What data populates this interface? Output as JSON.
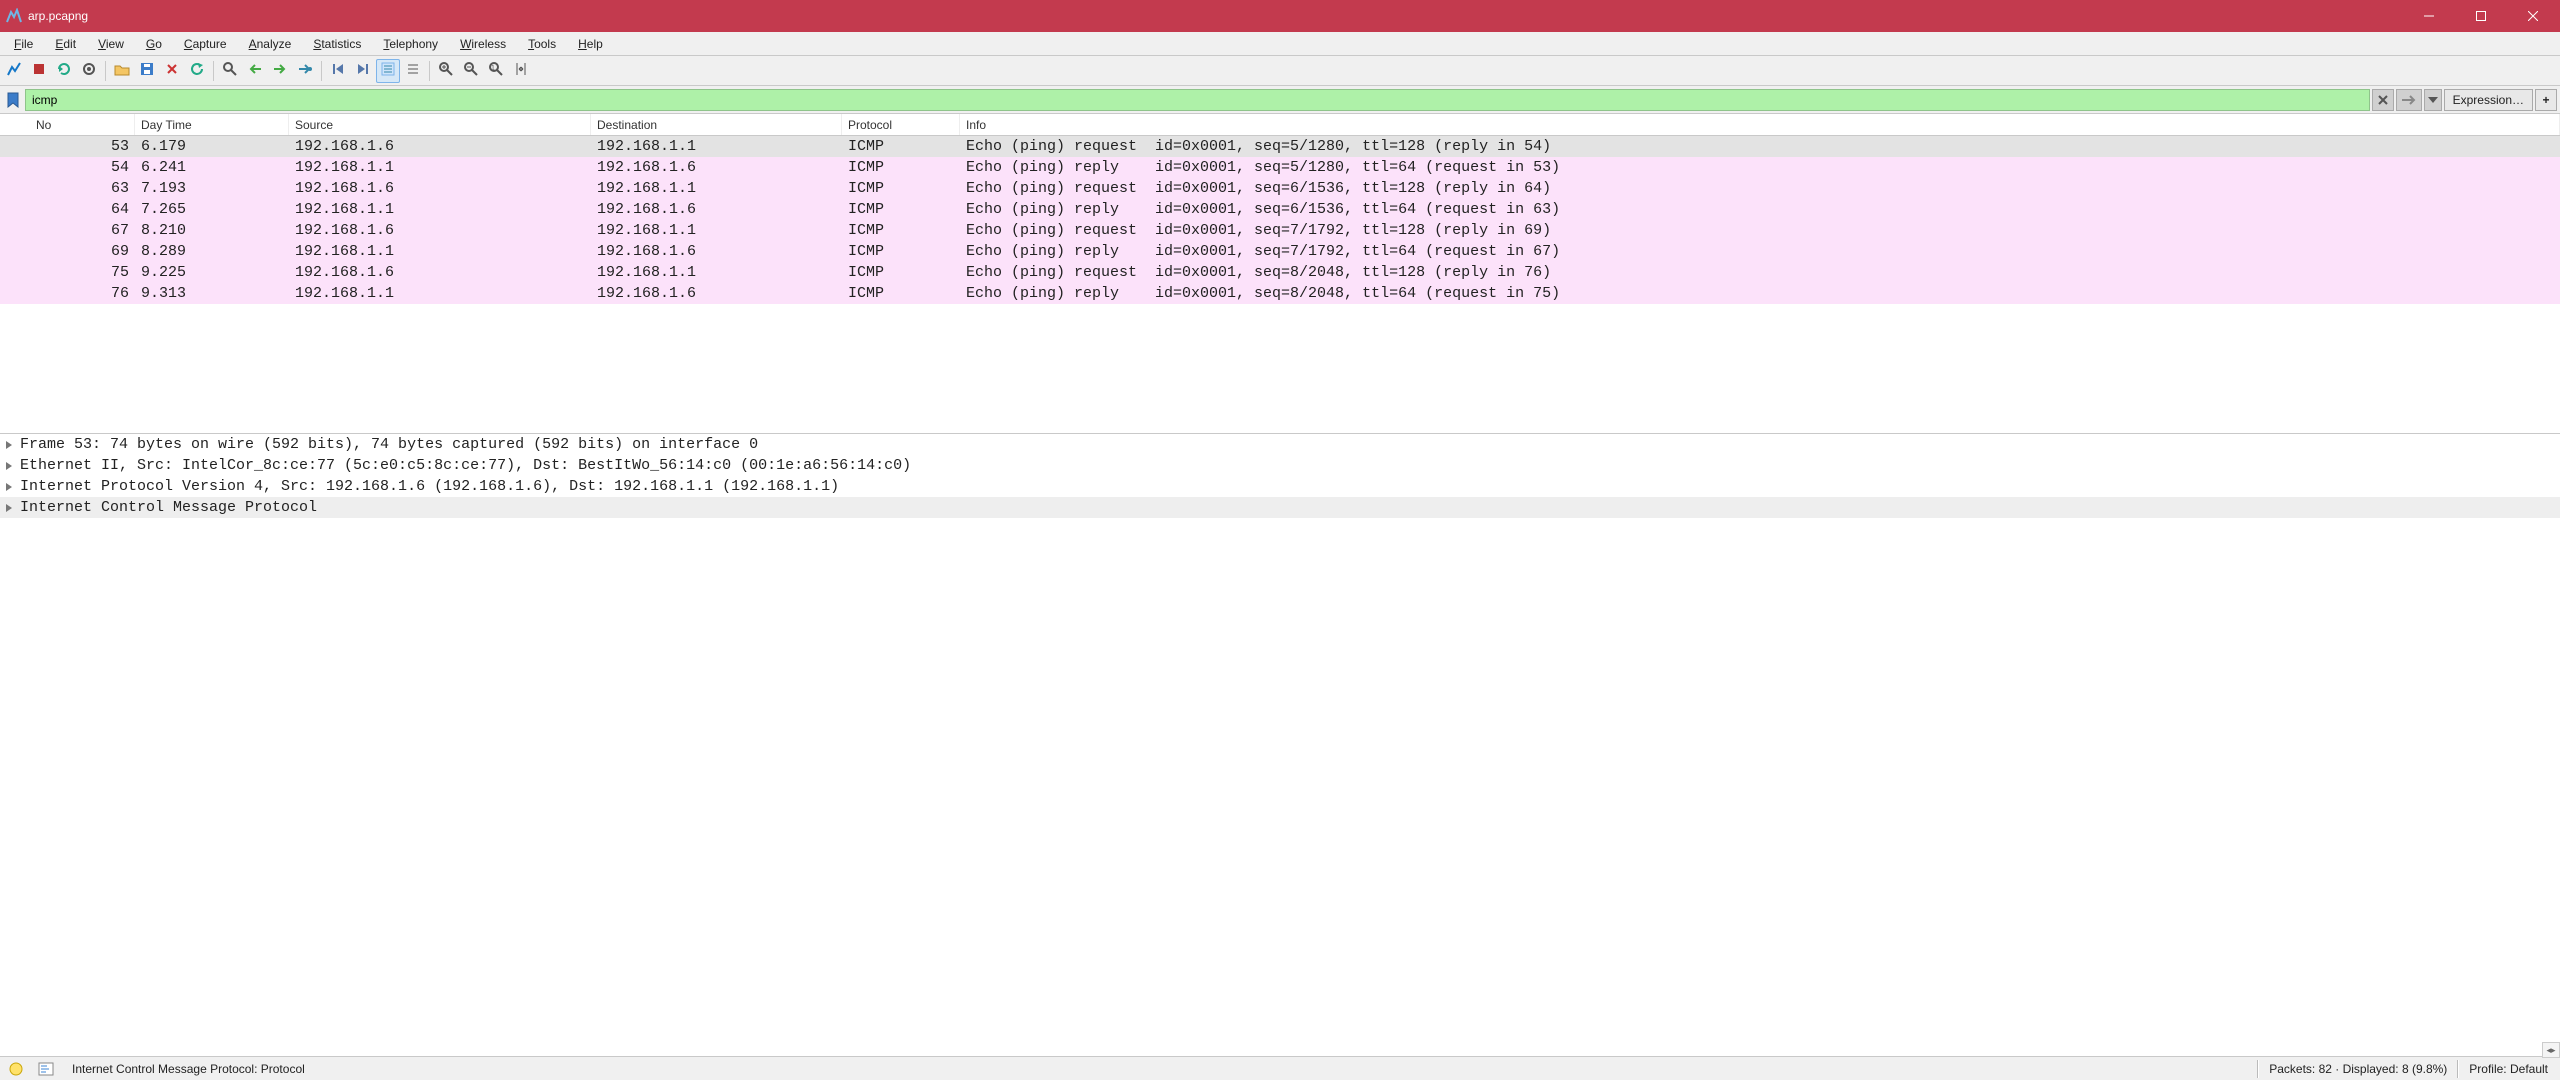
{
  "window": {
    "title": "arp.pcapng"
  },
  "menubar": [
    {
      "label": "File",
      "mn": "F"
    },
    {
      "label": "Edit",
      "mn": "E"
    },
    {
      "label": "View",
      "mn": "V"
    },
    {
      "label": "Go",
      "mn": "G"
    },
    {
      "label": "Capture",
      "mn": "C"
    },
    {
      "label": "Analyze",
      "mn": "A"
    },
    {
      "label": "Statistics",
      "mn": "S"
    },
    {
      "label": "Telephony",
      "mn": "T"
    },
    {
      "label": "Wireless",
      "mn": "W"
    },
    {
      "label": "Tools",
      "mn": "T"
    },
    {
      "label": "Help",
      "mn": "H"
    }
  ],
  "toolbar_icons": [
    "fin-start",
    "stop",
    "restart",
    "options",
    "sep",
    "open",
    "save",
    "close",
    "reload",
    "sep",
    "find",
    "back",
    "forward",
    "jump",
    "sep",
    "first",
    "last",
    "autoscroll-enabled",
    "autoscroll",
    "sep",
    "zoom-in",
    "zoom-out",
    "zoom-reset",
    "resize-cols"
  ],
  "filterbar": {
    "value": "icmp",
    "expression_label": "Expression…",
    "plus_label": "+"
  },
  "columns": {
    "no": "No",
    "dt": "Day Time",
    "src": "Source",
    "dst": "Destination",
    "prot": "Protocol",
    "info": "Info"
  },
  "packets": [
    {
      "no": "53",
      "dt": "6.179",
      "src": "192.168.1.6",
      "dst": "192.168.1.1",
      "prot": "ICMP",
      "info": "Echo (ping) request  id=0x0001, seq=5/1280, ttl=128 (reply in 54)",
      "selected": true
    },
    {
      "no": "54",
      "dt": "6.241",
      "src": "192.168.1.1",
      "dst": "192.168.1.6",
      "prot": "ICMP",
      "info": "Echo (ping) reply    id=0x0001, seq=5/1280, ttl=64 (request in 53)"
    },
    {
      "no": "63",
      "dt": "7.193",
      "src": "192.168.1.6",
      "dst": "192.168.1.1",
      "prot": "ICMP",
      "info": "Echo (ping) request  id=0x0001, seq=6/1536, ttl=128 (reply in 64)"
    },
    {
      "no": "64",
      "dt": "7.265",
      "src": "192.168.1.1",
      "dst": "192.168.1.6",
      "prot": "ICMP",
      "info": "Echo (ping) reply    id=0x0001, seq=6/1536, ttl=64 (request in 63)"
    },
    {
      "no": "67",
      "dt": "8.210",
      "src": "192.168.1.6",
      "dst": "192.168.1.1",
      "prot": "ICMP",
      "info": "Echo (ping) request  id=0x0001, seq=7/1792, ttl=128 (reply in 69)"
    },
    {
      "no": "69",
      "dt": "8.289",
      "src": "192.168.1.1",
      "dst": "192.168.1.6",
      "prot": "ICMP",
      "info": "Echo (ping) reply    id=0x0001, seq=7/1792, ttl=64 (request in 67)"
    },
    {
      "no": "75",
      "dt": "9.225",
      "src": "192.168.1.6",
      "dst": "192.168.1.1",
      "prot": "ICMP",
      "info": "Echo (ping) request  id=0x0001, seq=8/2048, ttl=128 (reply in 76)"
    },
    {
      "no": "76",
      "dt": "9.313",
      "src": "192.168.1.1",
      "dst": "192.168.1.6",
      "prot": "ICMP",
      "info": "Echo (ping) reply    id=0x0001, seq=8/2048, ttl=64 (request in 75)"
    }
  ],
  "details": [
    "Frame 53: 74 bytes on wire (592 bits), 74 bytes captured (592 bits) on interface 0",
    "Ethernet II, Src: IntelCor_8c:ce:77 (5c:e0:c5:8c:ce:77), Dst: BestItWo_56:14:c0 (00:1e:a6:56:14:c0)",
    "Internet Protocol Version 4, Src: 192.168.1.6 (192.168.1.6), Dst: 192.168.1.1 (192.168.1.1)",
    "Internet Control Message Protocol"
  ],
  "statusbar": {
    "left": "Internet Control Message Protocol: Protocol",
    "packets": "Packets: 82 · Displayed: 8 (9.8%)",
    "profile": "Profile: Default"
  }
}
